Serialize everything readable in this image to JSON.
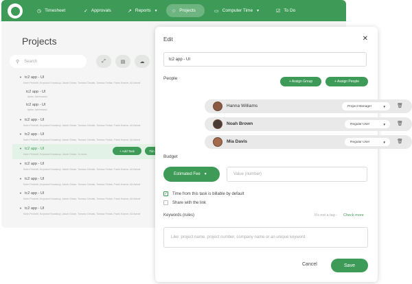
{
  "nav": {
    "items": [
      {
        "label": "Timesheet",
        "icon": "clock-icon"
      },
      {
        "label": "Approvals",
        "icon": "check-icon"
      },
      {
        "label": "Reports",
        "icon": "chart-icon"
      },
      {
        "label": "Projects",
        "icon": "star-icon"
      },
      {
        "label": "Computer Time",
        "icon": "monitor-icon"
      },
      {
        "label": "To Do",
        "icon": "todo-icon"
      }
    ]
  },
  "projects": {
    "title": "Projects",
    "search_placeholder": "Search",
    "rows": [
      {
        "title": "tc2 app - UI",
        "sub": "Karin Pedrotti, Krzysztof Kowalczy, Jakub Glowe, Tomasz Cieslak, Tomasz Fedak, Frank Kramer, Ali Ashraf"
      },
      {
        "title": "tc2 app - UI",
        "sub": "Aptac Jakimowski"
      },
      {
        "title": "tc2 app - UI",
        "sub": "Aptac Jakimowski"
      },
      {
        "title": "tc2 app - UI",
        "sub": "Karin Pedrotti, Krzysztof Kowalczy, Jakub Glowe, Tomasz Cieslak, Tomasz Fedak, Frank Kramer, Ali Ashraf"
      },
      {
        "title": "tc2 app - UI",
        "sub": "Karin Pedrotti, Krzysztof Kowalczy, Jakub Glowe, Tomasz Cieslak, Tomasz Fedak, Frank Kramer, Ali Ashraf"
      },
      {
        "title": "tc2 app - UI",
        "sub": "Karin Pedrotti, Krzysztof Kowalczy, Jakub Glowe, Jo more..."
      },
      {
        "title": "tc2 app - UI",
        "sub": "Karin Pedrotti, Krzysztof Kowalczy, Jakub Glowe, Tomasz Cieslak, Tomasz Fedak, Frank Kramer, Ali Ashraf"
      },
      {
        "title": "tc2 app - UI",
        "sub": "Karin Pedrotti, Krzysztof Kowalczy, Jakub Glowe, Tomasz Cieslak, Tomasz Fedak, Frank Kramer, Ali Ashraf"
      },
      {
        "title": "tc2 app - UI",
        "sub": "Karin Pedrotti, Krzysztof Kowalczy, Jakub Glowe, Tomasz Cieslak, Tomasz Fedak, Frank Kramer, Ali Ashraf"
      },
      {
        "title": "tc2 app - UI",
        "sub": "Karin Pedrotti, Krzysztof Kowalczy, Jakub Glowe, Tomasz Cieslak, Tomasz Fedak, Frank Kramer, Ali Ashraf"
      }
    ],
    "add_task_label": "+ Add Task",
    "second_button_label": "Tim"
  },
  "edit": {
    "title": "Edit",
    "name_value": "tc2 app - UI",
    "people_label": "People",
    "assign_group_label": "+ Assign Group",
    "assign_people_label": "+ Assign People",
    "people": [
      {
        "name": "Hanna Williams",
        "role": "Project Manager"
      },
      {
        "name": "Noah Brown",
        "role": "Regular User"
      },
      {
        "name": "Mia Davis",
        "role": "Regular User"
      }
    ],
    "budget_label": "Budget",
    "fee_label": "Estimated Fee",
    "value_placeholder": "Value (number)",
    "billable_label": "Time from this task is billable by default",
    "share_label": "Share with the link",
    "keywords_label": "Keywords (rules)",
    "tag_note": "It's not a tag -",
    "check_more": "Check more",
    "keywords_placeholder": "Like: project name, project number, company name or an unique keyword",
    "cancel_label": "Cancel",
    "save_label": "Save"
  },
  "colors": {
    "accent": "#3e9b57",
    "highlight": "#e3f2e6"
  }
}
